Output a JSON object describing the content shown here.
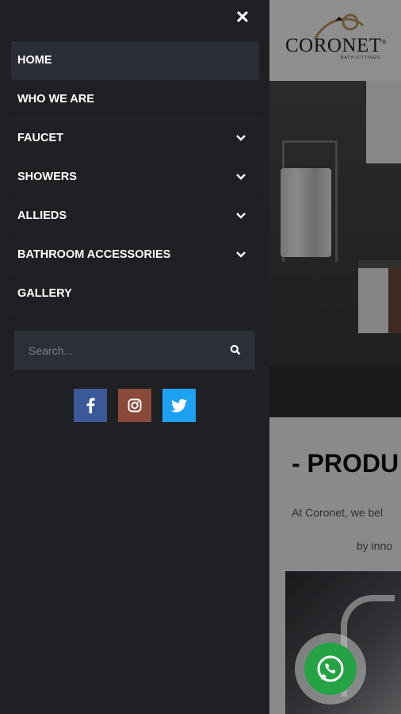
{
  "drawer": {
    "close_glyph": "✕",
    "menu": [
      {
        "label": "HOME",
        "active": true,
        "has_submenu": false
      },
      {
        "label": "WHO WE ARE",
        "active": false,
        "has_submenu": false
      },
      {
        "label": "FAUCET",
        "active": false,
        "has_submenu": true
      },
      {
        "label": "SHOWERS",
        "active": false,
        "has_submenu": true
      },
      {
        "label": "ALLIEDS",
        "active": false,
        "has_submenu": true
      },
      {
        "label": "BATHROOM ACCESSORIES",
        "active": false,
        "has_submenu": true
      },
      {
        "label": "GALLERY",
        "active": false,
        "has_submenu": false
      }
    ],
    "search": {
      "placeholder": "Search..."
    },
    "socials": [
      {
        "name": "facebook-icon",
        "color": "#3b5998"
      },
      {
        "name": "instagram-icon",
        "color": "#8a4a3a"
      },
      {
        "name": "twitter-icon",
        "color": "#1da1f2"
      }
    ]
  },
  "page": {
    "logo": {
      "word": "CORONET",
      "registered": "®",
      "tagline": "BATH FITTINGS"
    },
    "products_title": "- PRODU",
    "products_text_1": "At Coronet, we bel",
    "products_text_2": "by inno"
  },
  "colors": {
    "drawer_bg": "#1f2023",
    "active_item_bg": "#2b2e36",
    "search_bg": "#2c2f37",
    "logo_gold": "#b8935a",
    "whatsapp_green": "#25a244"
  },
  "icons": [
    "close-icon",
    "chevron-down-icon",
    "search-icon",
    "facebook-icon",
    "instagram-icon",
    "twitter-icon",
    "whatsapp-icon"
  ]
}
